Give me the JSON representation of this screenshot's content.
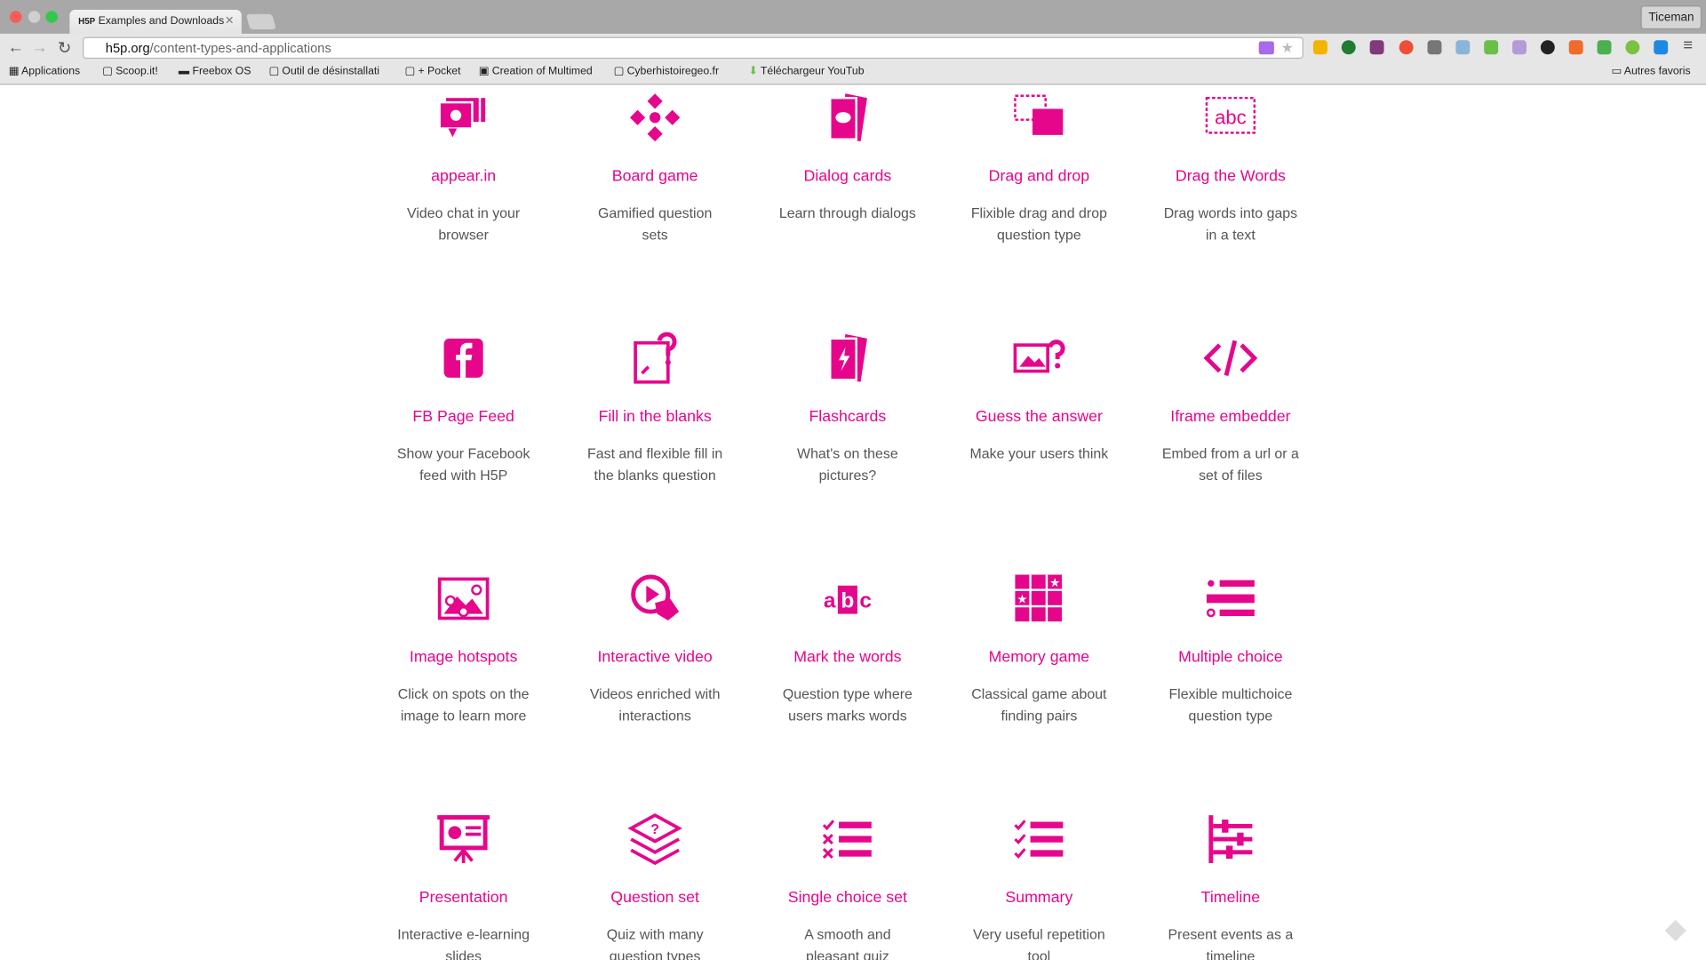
{
  "browser": {
    "tab_title": "Examples and Downloads",
    "tab_favicon": "H5P",
    "url_host": "h5p.org",
    "url_path": "/content-types-and-applications",
    "user": "Ticeman"
  },
  "bookmarks": [
    "Applications",
    "Scoop.it!",
    "Freebox OS",
    "Outil de désinstallati",
    "+ Pocket",
    "Creation of Multimed",
    "Cyberhistoiregeo.fr",
    "Téléchargeur YouTub"
  ],
  "other_bookmarks": "Autres favoris",
  "accent": "#e5068c",
  "items": [
    {
      "title": "appear.in",
      "desc": "Video chat in your browser",
      "icon": "video-chat"
    },
    {
      "title": "Board game",
      "desc": "Gamified question sets",
      "icon": "board-game"
    },
    {
      "title": "Dialog cards",
      "desc": "Learn through dialogs",
      "icon": "dialog-cards"
    },
    {
      "title": "Drag and drop",
      "desc": "Flixible drag and drop question type",
      "icon": "drag-drop"
    },
    {
      "title": "Drag the Words",
      "desc": "Drag words into gaps in a text",
      "icon": "drag-words"
    },
    {
      "title": "FB Page Feed",
      "desc": "Show your Facebook feed with H5P",
      "icon": "facebook"
    },
    {
      "title": "Fill in the blanks",
      "desc": "Fast and flexible fill in the blanks question",
      "icon": "fill-blanks"
    },
    {
      "title": "Flashcards",
      "desc": "What's on these pictures?",
      "icon": "flashcards"
    },
    {
      "title": "Guess the answer",
      "desc": "Make your users think",
      "icon": "guess-answer"
    },
    {
      "title": "Iframe embedder",
      "desc": "Embed from a url or a set of files",
      "icon": "code"
    },
    {
      "title": "Image hotspots",
      "desc": "Click on spots on the image to learn more",
      "icon": "image-hotspots"
    },
    {
      "title": "Interactive video",
      "desc": "Videos enriched with interactions",
      "icon": "interactive-video"
    },
    {
      "title": "Mark the words",
      "desc": "Question type where users marks words",
      "icon": "mark-words"
    },
    {
      "title": "Memory game",
      "desc": "Classical game about finding pairs",
      "icon": "memory-game"
    },
    {
      "title": "Multiple choice",
      "desc": "Flexible multichoice question type",
      "icon": "multiple-choice"
    },
    {
      "title": "Presentation",
      "desc": "Interactive e-learning slides",
      "icon": "presentation"
    },
    {
      "title": "Question set",
      "desc": "Quiz with many question types",
      "icon": "question-set"
    },
    {
      "title": "Single choice set",
      "desc": "A smooth and pleasant quiz",
      "icon": "single-choice"
    },
    {
      "title": "Summary",
      "desc": "Very useful repetition tool",
      "icon": "summary"
    },
    {
      "title": "Timeline",
      "desc": "Present events as a timeline",
      "icon": "timeline"
    }
  ]
}
